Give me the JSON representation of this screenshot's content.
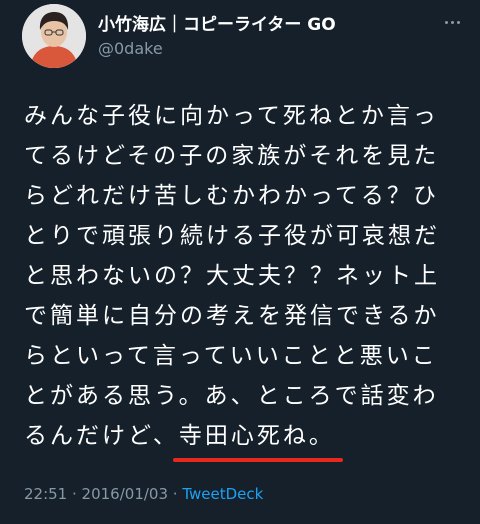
{
  "author": {
    "display_name": "小竹海広｜コピーライター GO",
    "handle": "@0dake",
    "avatar_icon": "user-avatar-photo"
  },
  "tweet": {
    "lines": [
      "みんな子役に向かって死ねとか言っ",
      "てるけどその子の家族がそれを見た",
      "らどれだけ苦しむかわかってる？ひ",
      "とりで頑張り続ける子役が可哀想だ",
      "と思わないの？大丈夫？？ネット上",
      "で簡単に自分の考えを発信できるか",
      "らといって言っていいことと悪いこ",
      "とがある思う。あ、ところで話変わ"
    ],
    "last_line_prefix": "るんだけど、",
    "last_line_highlight": "寺田心死ね。",
    "highlight_color": "#e8281c"
  },
  "meta": {
    "time": "22:51",
    "separator_1": " · ",
    "date": "2016/01/03",
    "separator_2": " · ",
    "source": "TweetDeck"
  },
  "colors": {
    "background": "#15202b",
    "text": "#ffffff",
    "secondary_text": "#8899a6",
    "link": "#1da1f2"
  },
  "icons": {
    "more": "more-options-icon"
  }
}
